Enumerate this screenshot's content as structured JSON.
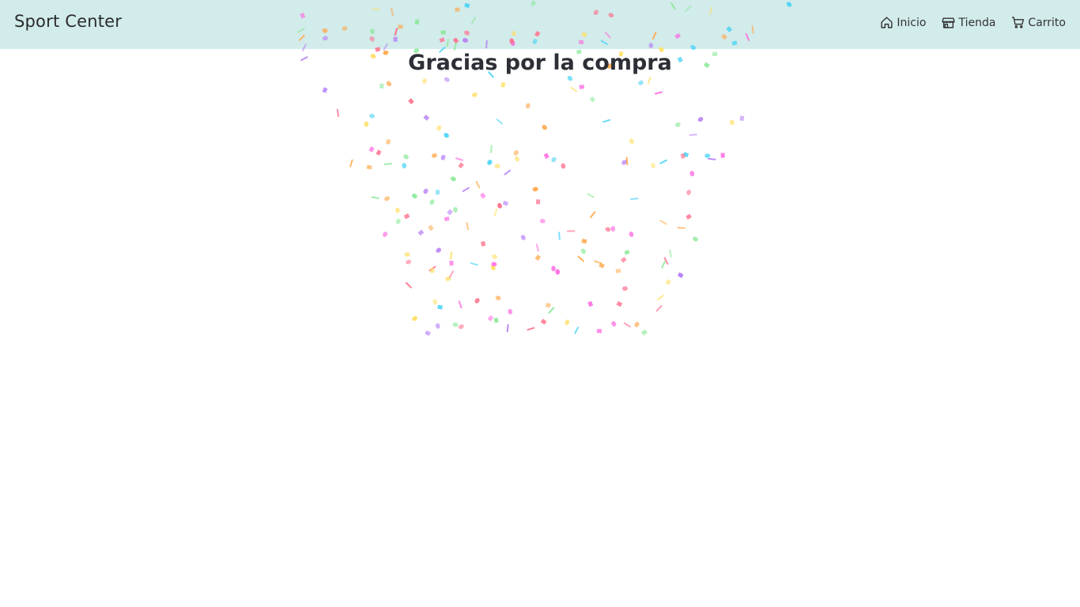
{
  "navbar": {
    "brand": "Sport Center",
    "links": [
      {
        "label": "Inicio",
        "icon": "house-icon"
      },
      {
        "label": "Tienda",
        "icon": "shop-icon"
      },
      {
        "label": "Carrito",
        "icon": "cart-icon"
      }
    ],
    "background": "#d2ebeb"
  },
  "main": {
    "title": "Gracias por la compra"
  },
  "confetti": {
    "colors": [
      "#ff6b8a",
      "#ffa94d",
      "#ffe066",
      "#8ce99a",
      "#4dd4f4",
      "#b57cf5",
      "#ff66e0"
    ]
  }
}
